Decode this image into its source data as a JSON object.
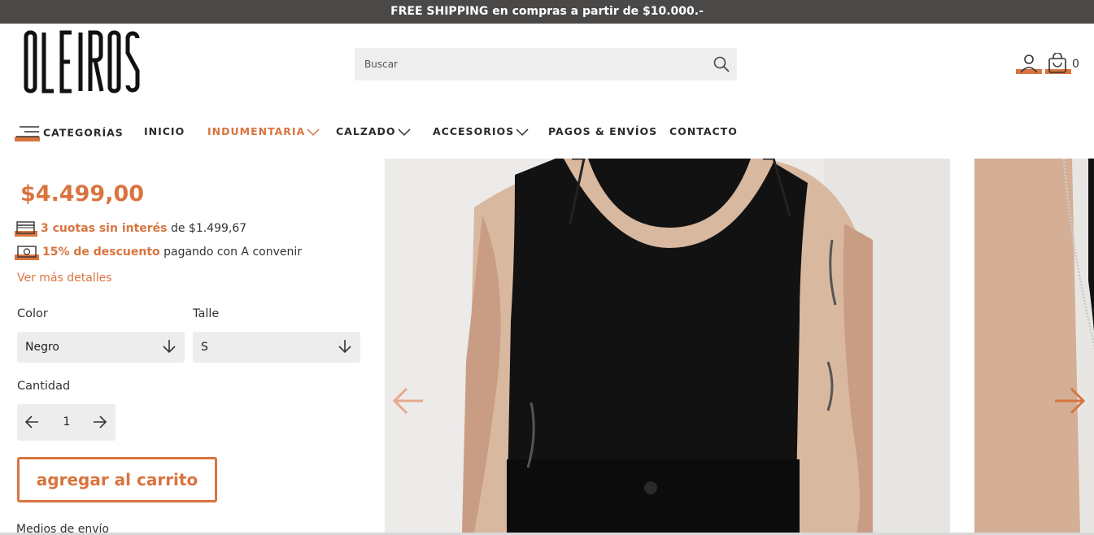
{
  "topbar": {
    "text": "FREE SHIPPING en compras a partir de $10.000.-"
  },
  "brand": {
    "logo_text": "OLEIROS",
    "accent_color": "#d9743f"
  },
  "search": {
    "placeholder": "Buscar",
    "icon": "search-icon"
  },
  "header": {
    "cart_count": "0",
    "account_icon": "user-icon",
    "cart_icon": "shopping-bag-icon"
  },
  "nav": {
    "categories_label": "CATEGORÍAS",
    "items": [
      {
        "label": "INICIO"
      },
      {
        "label": "INDUMENTARIA"
      },
      {
        "label": "CALZADO"
      },
      {
        "label": "ACCESORIOS"
      },
      {
        "label": "PAGOS & ENVÍOS"
      },
      {
        "label": "CONTACTO"
      }
    ]
  },
  "product": {
    "price": "$4.499,00",
    "installments_highlight": "3 cuotas sin interés",
    "installments_rest": " de $1.499,67",
    "discount_highlight": "15% de descuento",
    "discount_rest": " pagando con A convenir",
    "more_details": "Ver más detalles",
    "color_label": "Color",
    "color_value": "Negro",
    "size_label": "Talle",
    "size_value": "S",
    "quantity_label": "Cantidad",
    "quantity_value": "1",
    "add_to_cart": "agregar al carrito",
    "shipping_label": "Medios de envío"
  }
}
